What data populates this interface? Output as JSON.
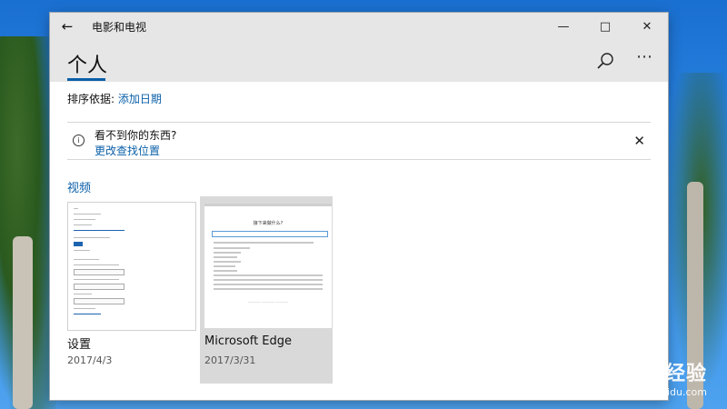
{
  "window": {
    "title": "电影和电视"
  },
  "titlebar": {
    "back_icon": "back-arrow-icon",
    "minimize_icon": "minimize-icon",
    "maximize_icon": "maximize-icon",
    "close_icon": "close-icon"
  },
  "header": {
    "page_title": "个人",
    "search_icon": "search-icon",
    "more_icon": "more-icon"
  },
  "sort": {
    "label": "排序依据:",
    "value": "添加日期"
  },
  "notice": {
    "title": "看不到你的东西?",
    "link": "更改查找位置"
  },
  "section": {
    "title": "视频"
  },
  "videos": [
    {
      "name": "设置",
      "date": "2017/4/3",
      "selected": false
    },
    {
      "name": "Microsoft Edge",
      "date": "2017/3/31",
      "selected": true
    }
  ],
  "watermark": {
    "main": "Baidu经验",
    "sub": "jingyan.baidu.com"
  },
  "colors": {
    "accent": "#0a5fa8",
    "titlebar_bg": "#e6e6e6",
    "selected_tile_bg": "#d9d9d9"
  }
}
